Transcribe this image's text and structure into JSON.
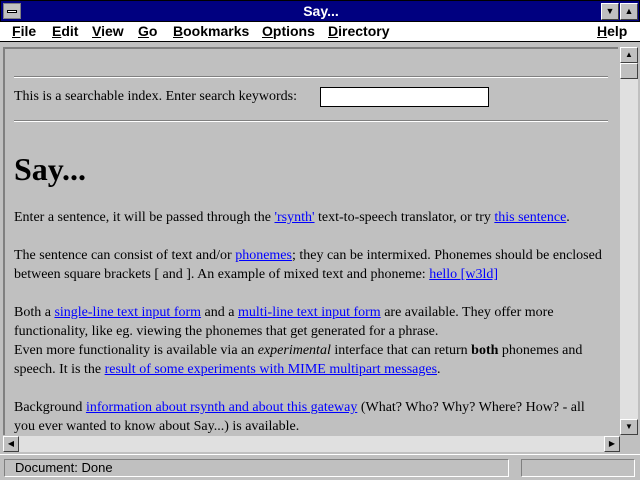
{
  "window": {
    "title": "Say..."
  },
  "menu": [
    {
      "pre": "",
      "key": "F",
      "rest": "ile"
    },
    {
      "pre": "",
      "key": "E",
      "rest": "dit"
    },
    {
      "pre": "",
      "key": "V",
      "rest": "iew"
    },
    {
      "pre": "",
      "key": "G",
      "rest": "o"
    },
    {
      "pre": "",
      "key": "B",
      "rest": "ookmarks"
    },
    {
      "pre": "",
      "key": "O",
      "rest": "ptions"
    },
    {
      "pre": "",
      "key": "D",
      "rest": "irectory"
    },
    {
      "pre": "",
      "key": "H",
      "rest": "elp"
    }
  ],
  "page": {
    "search_label": "This is a searchable index. Enter search keywords:",
    "search_value": "",
    "heading": "Say...",
    "p1": {
      "t1": "Enter a sentence, it will be passed through the ",
      "l1": "'rsynth'",
      "t2": " text-to-speech translator, or try ",
      "l2": "this sentence",
      "t3": "."
    },
    "p2": {
      "t1": "The sentence can consist of text and/or ",
      "l1": "phonemes",
      "t2": "; they can be intermixed. Phonemes should be enclosed between square brackets [ and ]. An example of mixed text and phoneme: ",
      "l2": "hello [w3ld]"
    },
    "p3": {
      "t1": "Both a ",
      "l1": "single-line text input form",
      "t2": " and a ",
      "l2": "multi-line text input form",
      "t3": " are available. They offer more functionality, like eg. viewing the phonemes that get generated for a phrase."
    },
    "p4": {
      "t1": "Even more functionality is available via an ",
      "em": "experimental",
      "t2": " interface that can return ",
      "b": "both",
      "t3": " phonemes and speech. It is the ",
      "l1": "result of some experiments with MIME multipart messages",
      "t4": "."
    },
    "p5": {
      "t1": "Background ",
      "l1": "information about rsynth and about this gateway",
      "t2": " (What? Who? Why? Where? How? - all you ever wanted to know about Say...) is available."
    }
  },
  "status": {
    "text": "Document: Done"
  },
  "icons": {
    "system_menu": "system-menu-icon",
    "minimize": "minimize-icon",
    "maximize": "maximize-icon",
    "scroll_up": "scroll-up-icon",
    "scroll_down": "scroll-down-icon",
    "scroll_left": "scroll-left-icon",
    "scroll_right": "scroll-right-icon"
  },
  "colors": {
    "titlebar": "#000080",
    "link": "#0000ff",
    "background": "#c0c0c0"
  }
}
